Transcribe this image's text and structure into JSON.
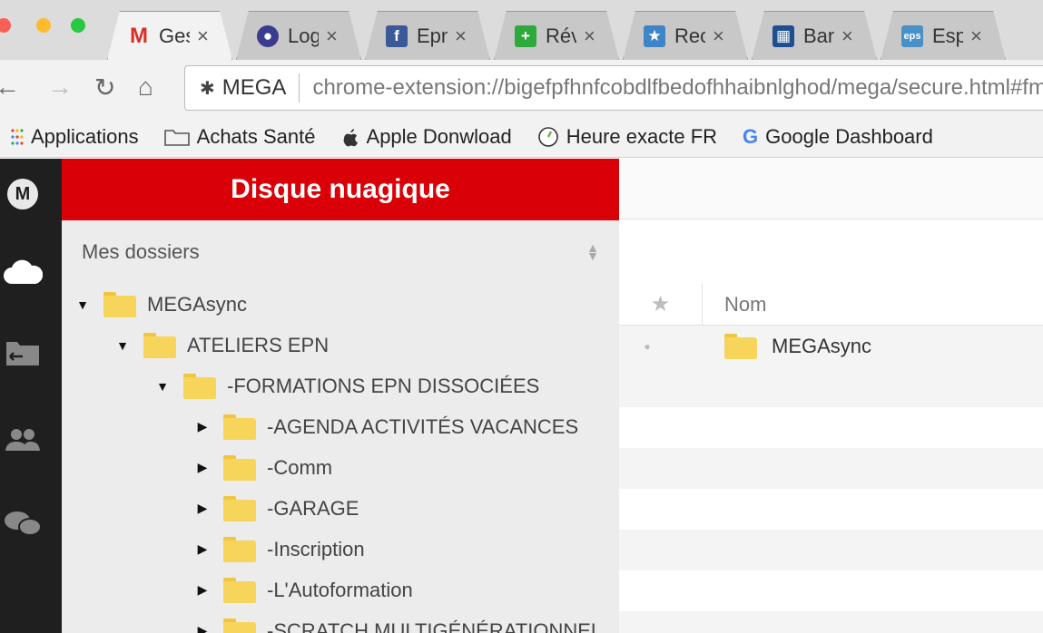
{
  "browser": {
    "tabs": [
      {
        "label": "Ges",
        "icon": "gmail-icon",
        "color": "#d93025",
        "glyph": "M"
      },
      {
        "label": "Logi",
        "icon": "user-circle-icon",
        "color": "#3b3b8f",
        "glyph": "●"
      },
      {
        "label": "Epn",
        "icon": "facebook-icon",
        "color": "#3b5998",
        "glyph": "f"
      },
      {
        "label": "Rév",
        "icon": "plus-icon",
        "color": "#2eaa3c",
        "glyph": "+"
      },
      {
        "label": "Rec",
        "icon": "star-badge-icon",
        "color": "#3d85c6",
        "glyph": "★"
      },
      {
        "label": "Ban",
        "icon": "bank-icon",
        "color": "#1d4f91",
        "glyph": "▦"
      },
      {
        "label": "Esp",
        "icon": "eps-icon",
        "color": "#4a90c8",
        "glyph": "eps"
      }
    ],
    "tab_close_glyph": "×",
    "omnibox": {
      "site_label": "MEGA",
      "url": "chrome-extension://bigefpfhnfcobdlfbedofhhaibnlghod/mega/secure.html#fm/"
    },
    "bookmarks": [
      {
        "label": "Applications",
        "icon": "apps-grid-icon"
      },
      {
        "label": "Achats Santé",
        "icon": "folder-outline-icon"
      },
      {
        "label": "Apple Donwload",
        "icon": "apple-icon"
      },
      {
        "label": "Heure exacte FR",
        "icon": "clock-icon"
      },
      {
        "label": "Google Dashboard",
        "icon": "google-icon"
      }
    ]
  },
  "app": {
    "rail_logo": "M",
    "panel_title": "Disque nuagique",
    "section_label": "Mes dossiers",
    "tree": [
      {
        "label": "MEGAsync",
        "depth": 0,
        "expanded": true
      },
      {
        "label": "ATELIERS EPN",
        "depth": 1,
        "expanded": true
      },
      {
        "label": "-FORMATIONS EPN DISSOCIÉES",
        "depth": 2,
        "expanded": true
      },
      {
        "label": "-AGENDA ACTIVITÉS VACANCES",
        "depth": 3,
        "expanded": false
      },
      {
        "label": "-Comm",
        "depth": 3,
        "expanded": false
      },
      {
        "label": "-GARAGE",
        "depth": 3,
        "expanded": false
      },
      {
        "label": "-Inscription",
        "depth": 3,
        "expanded": false
      },
      {
        "label": "-L'Autoformation",
        "depth": 3,
        "expanded": false
      },
      {
        "label": "-SCRATCH MULTIGÉNÉRATIONNEL",
        "depth": 3,
        "expanded": false
      }
    ],
    "list": {
      "column_name": "Nom",
      "files": [
        {
          "name": "MEGAsync"
        }
      ]
    }
  },
  "colors": {
    "mega_red": "#d90007",
    "folder_yellow": "#f7d55b",
    "rail_dark": "#1f1f1f"
  }
}
